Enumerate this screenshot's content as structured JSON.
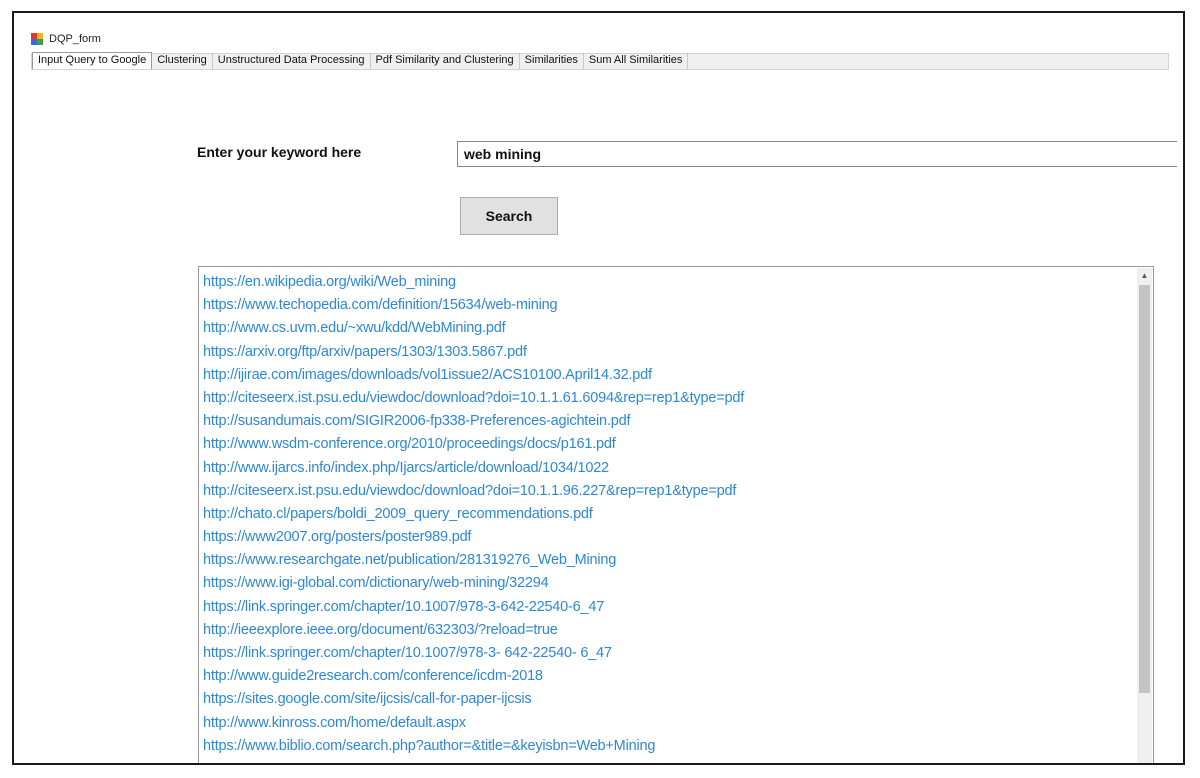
{
  "window": {
    "title": "DQP_form",
    "icon": "app-icon"
  },
  "tabs": [
    {
      "label": "Input Query to Google",
      "active": true
    },
    {
      "label": "Clustering",
      "active": false
    },
    {
      "label": "Unstructured Data Processing",
      "active": false
    },
    {
      "label": "Pdf Similarity and Clustering",
      "active": false
    },
    {
      "label": "Similarities",
      "active": false
    },
    {
      "label": "Sum All Similarities",
      "active": false
    }
  ],
  "form": {
    "keyword_label": "Enter your keyword here",
    "keyword_value": "web mining",
    "search_label": "Search"
  },
  "results": [
    "https://en.wikipedia.org/wiki/Web_mining",
    "https://www.techopedia.com/definition/15634/web-mining",
    "http://www.cs.uvm.edu/~xwu/kdd/WebMining.pdf",
    "https://arxiv.org/ftp/arxiv/papers/1303/1303.5867.pdf",
    "http://ijirae.com/images/downloads/vol1issue2/ACS10100.April14.32.pdf",
    "http://citeseerx.ist.psu.edu/viewdoc/download?doi=10.1.1.61.6094&rep=rep1&type=pdf",
    "http://susandumais.com/SIGIR2006-fp338-Preferences-agichtein.pdf",
    "http://www.wsdm-conference.org/2010/proceedings/docs/p161.pdf",
    "http://www.ijarcs.info/index.php/Ijarcs/article/download/1034/1022",
    "http://citeseerx.ist.psu.edu/viewdoc/download?doi=10.1.1.96.227&rep=rep1&type=pdf",
    "http://chato.cl/papers/boldi_2009_query_recommendations.pdf",
    "https://www2007.org/posters/poster989.pdf",
    "https://www.researchgate.net/publication/281319276_Web_Mining",
    "https://www.igi-global.com/dictionary/web-mining/32294",
    "https://link.springer.com/chapter/10.1007/978-3-642-22540-6_47",
    "http://ieeexplore.ieee.org/document/632303/?reload=true",
    "https://link.springer.com/chapter/10.1007/978-3- 642-22540- 6_47",
    "http://www.guide2research.com/conference/icdm-2018",
    "https://sites.google.com/site/ijcsis/call-for-paper-ijcsis",
    "http://www.kinross.com/home/default.aspx",
    "https://www.biblio.com/search.php?author=&title=&keyisbn=Web+Mining"
  ],
  "colors": {
    "link": "#2e87d6",
    "button_bg": "#e1e1e1",
    "tabstrip_bg": "#f0f0f0"
  }
}
